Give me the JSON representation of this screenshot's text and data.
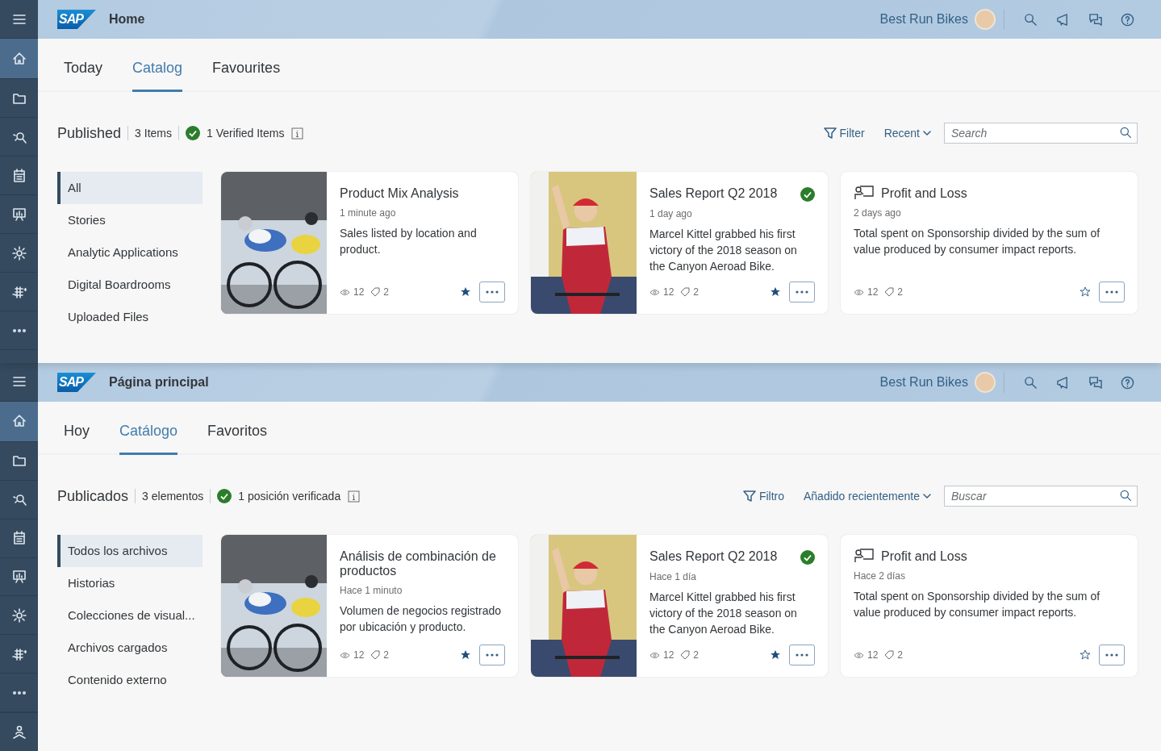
{
  "panels": [
    {
      "shell": {
        "logo": "SAP",
        "title": "Home",
        "company": "Best Run Bikes"
      },
      "rail": [
        {
          "kind": "menu",
          "selected": false
        },
        {
          "kind": "home",
          "selected": true
        },
        {
          "kind": "folder",
          "selected": false
        },
        {
          "kind": "insight",
          "selected": false
        },
        {
          "kind": "calendar",
          "selected": false
        },
        {
          "kind": "presentation",
          "selected": false
        },
        {
          "kind": "gear",
          "selected": false
        },
        {
          "kind": "grid",
          "selected": false
        },
        {
          "kind": "more",
          "selected": false
        }
      ],
      "tabs": [
        {
          "label": "Today",
          "selected": false
        },
        {
          "label": "Catalog",
          "selected": true
        },
        {
          "label": "Favourites",
          "selected": false
        }
      ],
      "toolbar": {
        "title": "Published",
        "count": "3 Items",
        "verified": "1 Verified Items",
        "filter": "Filter",
        "sort": "Recent",
        "search_placeholder": "Search"
      },
      "sidebar": [
        {
          "label": "All",
          "selected": true
        },
        {
          "label": "Stories",
          "selected": false
        },
        {
          "label": "Analytic Applications",
          "selected": false
        },
        {
          "label": "Digital Boardrooms",
          "selected": false
        },
        {
          "label": "Uploaded Files",
          "selected": false
        }
      ],
      "cards": [
        {
          "kind": "picture",
          "title": "Product Mix Analysis",
          "time": "1 minute ago",
          "description": "Sales listed by location and product.",
          "views": "12",
          "comments": "2",
          "verified": false,
          "favorite": true
        },
        {
          "kind": "picture",
          "title": "Sales Report Q2 2018",
          "time": "1 day ago",
          "description": "Marcel Kittel grabbed his first victory of the 2018 season on the Canyon Aeroad Bike.",
          "views": "12",
          "comments": "2",
          "verified": true,
          "favorite": true
        },
        {
          "kind": "model",
          "title": "Profit and Loss",
          "time": "2 days ago",
          "description": "Total spent on Sponsorship divided by the sum of value produced by consumer impact reports.",
          "views": "12",
          "comments": "2",
          "verified": false,
          "favorite": false
        }
      ]
    },
    {
      "shell": {
        "logo": "SAP",
        "title": "Página principal",
        "company": "Best Run Bikes"
      },
      "rail": [
        {
          "kind": "menu",
          "selected": false
        },
        {
          "kind": "home",
          "selected": true
        },
        {
          "kind": "folder",
          "selected": false
        },
        {
          "kind": "insight",
          "selected": false
        },
        {
          "kind": "calendar",
          "selected": false
        },
        {
          "kind": "presentation",
          "selected": false
        },
        {
          "kind": "gear",
          "selected": false
        },
        {
          "kind": "grid",
          "selected": false
        },
        {
          "kind": "more",
          "selected": false
        },
        {
          "kind": "person",
          "selected": false
        }
      ],
      "tabs": [
        {
          "label": "Hoy",
          "selected": false
        },
        {
          "label": "Catálogo",
          "selected": true
        },
        {
          "label": "Favoritos",
          "selected": false
        }
      ],
      "toolbar": {
        "title": "Publicados",
        "count": "3 elementos",
        "verified": "1 posición verificada",
        "filter": "Filtro",
        "sort": "Añadido recientemente",
        "search_placeholder": "Buscar"
      },
      "sidebar": [
        {
          "label": "Todos los archivos",
          "selected": true
        },
        {
          "label": "Historias",
          "selected": false
        },
        {
          "label": "Colecciones de visual...",
          "selected": false
        },
        {
          "label": "Archivos cargados",
          "selected": false
        },
        {
          "label": "Contenido externo",
          "selected": false
        }
      ],
      "cards": [
        {
          "kind": "picture",
          "title": "Análisis de combinación de productos",
          "time": "Hace 1 minuto",
          "description": "Volumen de negocios registrado por ubicación y producto.",
          "views": "12",
          "comments": "2",
          "verified": false,
          "favorite": true
        },
        {
          "kind": "picture",
          "title": "Sales Report Q2 2018",
          "time": "Hace 1 día",
          "description": "Marcel Kittel grabbed his first victory of the 2018 season on the Canyon Aeroad Bike.",
          "views": "12",
          "comments": "2",
          "verified": true,
          "favorite": true
        },
        {
          "kind": "model",
          "title": "Profit and Loss",
          "time": "Hace 2 días",
          "description": "Total spent on Sponsorship divided by the sum of value produced by consumer impact reports.",
          "views": "12",
          "comments": "2",
          "verified": false,
          "favorite": false
        }
      ]
    }
  ]
}
